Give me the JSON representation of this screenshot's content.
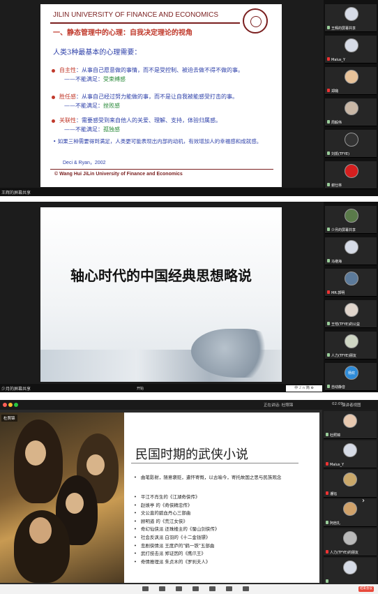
{
  "panel1": {
    "slide": {
      "university": "JILIN UNIVERSITY OF FINANCE AND ECONOMICS",
      "title": "一、静态管理中的心理：自我决定理论的视角",
      "intro": "人类3种最基本的心理需要：",
      "needs": [
        {
          "key": "自主性",
          "desc": "：从事自己愿意做的事情，而不是受控制、被迫去做不得不做的事。",
          "unsat_prefix": "——不能满足：",
          "unsat": "受束缚感"
        },
        {
          "key": "胜任感",
          "desc": "：从事自己经过努力能做的事，而不是让自我被能感受打击的事。",
          "unsat_prefix": "——不能满足：",
          "unsat": "挫败感"
        },
        {
          "key": "关联性",
          "desc": "：需要感受到来自他人的关爱、理解、支持，体验归属感。",
          "unsat_prefix": "——不能满足：",
          "unsat": "孤独感"
        }
      ],
      "summary": "• 如果三种需要得到满足，人类更可能表现出内部的动机，有效增加人的幸福感和成就感。",
      "citation": "Deci & Ryan，2002",
      "copyright": "© Wang Hui JiLin University of Finance and Economics"
    },
    "owner_label": "王辉的屏幕共享",
    "participants": [
      {
        "name": "王辉的屏幕共享",
        "mic": "on"
      },
      {
        "name": "Malus_Y",
        "mic": "off"
      },
      {
        "name": "郑璐",
        "mic": "off"
      },
      {
        "name": "周毅伟",
        "mic": "on"
      },
      {
        "name": "刘凯(TFYE)",
        "mic": "on"
      },
      {
        "name": "谢仕林",
        "mic": "on"
      }
    ]
  },
  "panel2": {
    "slide_title": "轴心时代的中国经典思想略说",
    "start_label": "开始",
    "owner_label": "少月的屏幕共享",
    "sticker_text": "中 ♪ ∩ 简 ⊕",
    "participants": [
      {
        "name": "少月的屏幕共享",
        "mic": "on"
      },
      {
        "name": "马继海",
        "mic": "on"
      },
      {
        "name": "MR.郭明",
        "mic": "off"
      },
      {
        "name": "王恺(TFYE)的公益",
        "mic": "on"
      },
      {
        "name": "人力(TFYE)朋友",
        "mic": "on"
      },
      {
        "name": "自动静音",
        "mic": "on"
      }
    ],
    "avatar_text": "杨欢"
  },
  "panel3": {
    "meeting_label": "正在讲话: 杜照锦",
    "time": "02:09",
    "layout_label": "演讲者视图",
    "shared_by": "杜照锦",
    "slide": {
      "title": "民国时期的武侠小说",
      "intro": "曲笔影射，随意褒贬，遣怀寄慨，以古喻今，寄托故国之思与民族观念",
      "items": [
        "平江不肖生的《江湖奇侠传》",
        "赵焕亭 的《奇侠精忠传》",
        "文公直的碧血丹心三部曲",
        "顾明道 的《荒江女侠》",
        "奇幻仙侠派 还珠楼主的《蜀山剑侠传》",
        "社会反讽派 白羽的《十二金钱镖》",
        "悲剧侠情派 王度庐的\"鹤一铁\"五部曲",
        "武打技击派 郑证因的《鹰爪王》",
        "奇情推理派 朱贞木的《罗刹夫人》"
      ]
    },
    "participants": [
      {
        "name": "杜照锦",
        "mic": "on"
      },
      {
        "name": "Malus_Y",
        "mic": "off"
      },
      {
        "name": "潘钰",
        "mic": "off"
      },
      {
        "name": "阿芭扎",
        "mic": "on"
      },
      {
        "name": "人力(TFYE)的朋友",
        "mic": "off"
      },
      {
        "name": "",
        "mic": "on"
      }
    ],
    "end_label": "结束会议"
  },
  "colors": {
    "accent_red": "#c0392b",
    "text_blue": "#2b3ea8",
    "unsat_green": "#2a8a3a",
    "dark_red": "#7a1f1f",
    "end_red": "#e84a3c"
  }
}
